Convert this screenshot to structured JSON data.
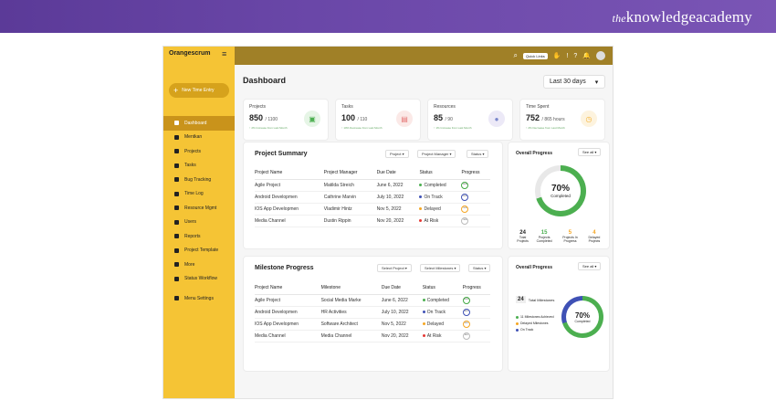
{
  "banner": {
    "brand_prefix": "the",
    "brand_name": "knowledgeacademy"
  },
  "app": {
    "logo": "Orangescrum",
    "new_time_entry": "New Time Entry",
    "header": {
      "quick_links": "Quick Links"
    },
    "nav": [
      "Dashboard",
      "Mentkan",
      "Projects",
      "Tasks",
      "Bug Tracking",
      "Time Log",
      "Resource Mgmt",
      "Users",
      "Reports",
      "Project Template",
      "More",
      "Status Workflow",
      "Menu Settings"
    ],
    "dashboard": {
      "title": "Dashboard",
      "range": "Last 30 days",
      "cards": [
        {
          "label": "Projects",
          "value": "850",
          "total": "/ 1100",
          "sub": "↑ 2% Increase from Last Month",
          "color": "#4caf50"
        },
        {
          "label": "Tasks",
          "value": "100",
          "total": "/ 110",
          "sub": "↑ 10% Decrease from Last Month",
          "color": "#e57373"
        },
        {
          "label": "Resources",
          "value": "85",
          "total": "/ 90",
          "sub": "↑ 1% Increase from Last Month",
          "color": "#7986cb"
        },
        {
          "label": "Time Spent",
          "value": "752",
          "total": "/ 865 hours",
          "sub": "↑ 2% Decrease from Last Month",
          "color": "#f5b335"
        }
      ]
    },
    "project_summary": {
      "title": "Project Summary",
      "filters": [
        "Project",
        "Project Manager",
        "Status"
      ],
      "headers": [
        "Project Name",
        "Project Manager",
        "Due Date",
        "Status",
        "Progress"
      ],
      "rows": [
        [
          "Agile Project",
          "Matilda Streich",
          "June 6, 2022",
          "Completed",
          "100%"
        ],
        [
          "Android Developmen",
          "Cathrine Marvin",
          "July 10, 2022",
          "On Track",
          "60%"
        ],
        [
          "IOS App Developmen",
          "Vladimir Hintz",
          "Nov 5, 2022",
          "Delayed",
          "50%"
        ],
        [
          "Media Channel",
          "Dustin Rippin",
          "Nov 20, 2022",
          "At Risk",
          "30%"
        ]
      ]
    },
    "overall_progress_1": {
      "title": "Overall Progress",
      "filter": "See all",
      "percent": "70%",
      "caption": "Completed",
      "stats": [
        {
          "value": "24",
          "label": "Total Projects"
        },
        {
          "value": "15",
          "label": "Projects Completed"
        },
        {
          "value": "5",
          "label": "Projects In Progress"
        },
        {
          "value": "4",
          "label": "Delayed Projects"
        }
      ]
    },
    "milestone": {
      "title": "Milestone Progress",
      "filters": [
        "Select Project",
        "Select Milestones",
        "Status"
      ],
      "headers": [
        "Project Name",
        "Milestone",
        "Due Date",
        "Status",
        "Progress"
      ],
      "rows": [
        [
          "Agile Project",
          "Social Media Marke",
          "June 6, 2022",
          "Completed",
          "100%"
        ],
        [
          "Android Developmen",
          "HR Activities",
          "July 10, 2022",
          "On Track",
          "60%"
        ],
        [
          "IOS App Developmen",
          "Software Architect",
          "Nov 5, 2022",
          "Delayed",
          "50%"
        ],
        [
          "Media Channel",
          "Media Channel",
          "Nov 20, 2022",
          "At Risk",
          "30%"
        ]
      ]
    },
    "overall_progress_2": {
      "title": "Overall Progress",
      "filter": "See all",
      "total": "24",
      "total_label": "Total Milestones",
      "legend": [
        "11 Milestones Achieved",
        "Delayed Milestones",
        "On Track"
      ],
      "percent": "70%",
      "caption": "Completed"
    },
    "status_colors": {
      "Completed": "#4caf50",
      "On Track": "#3f51b5",
      "Delayed": "#f5a623",
      "At Risk": "#e53935"
    }
  }
}
